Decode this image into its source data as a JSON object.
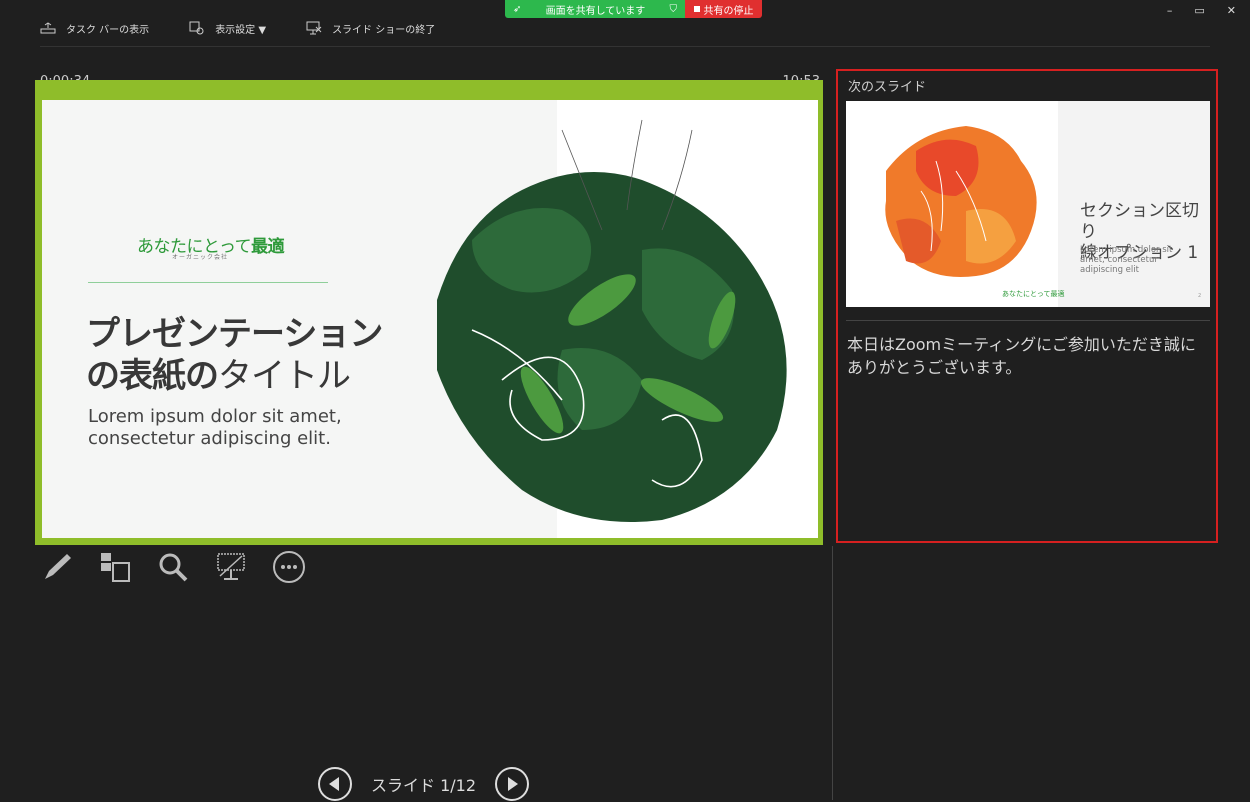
{
  "share_banner": {
    "sharing_text": "画面を共有しています",
    "stop_label": "共有の停止"
  },
  "toolbar": {
    "taskbar_label": "タスク バーの表示",
    "display_settings_label": "表示設定 ▼",
    "end_show_label": "スライド ショーの終了"
  },
  "window_controls": {
    "minimize": "–",
    "restore": "▭",
    "close": "✕"
  },
  "presenter": {
    "elapsed_time": "0:00:34",
    "clock": "10:53"
  },
  "current_slide": {
    "brand_main": "あなたにとって",
    "brand_bold": "最適",
    "brand_sub": "オーガニック会社",
    "title_line1": "プレゼンテーション",
    "title_line2_bold": "の表紙の",
    "title_line2_light": "タイトル",
    "subtitle_line1": "Lorem ipsum dolor sit amet,",
    "subtitle_line2": "consectetur adipiscing elit."
  },
  "next_slide": {
    "label": "次のスライド",
    "thumb_title_line1": "セクション区切り",
    "thumb_title_line2": "線オプション 1",
    "thumb_body": "Lorem ipsum dolor sit amet, consectetur adipiscing elit",
    "thumb_brand": "あなたにとって最適",
    "thumb_page": "2"
  },
  "notes": "本日はZoomミーティングにご参加いただき誠にありがとうございます。",
  "navigation": {
    "slide_counter": "スライド 1/12"
  },
  "tools": [
    "pen-icon",
    "slides-grid-icon",
    "zoom-icon",
    "black-screen-icon",
    "more-icon"
  ],
  "colors": {
    "slide_frame": "#8fbd2a",
    "panel_border": "#d62020",
    "share_green": "#2db84d",
    "share_red": "#e02f2f"
  }
}
